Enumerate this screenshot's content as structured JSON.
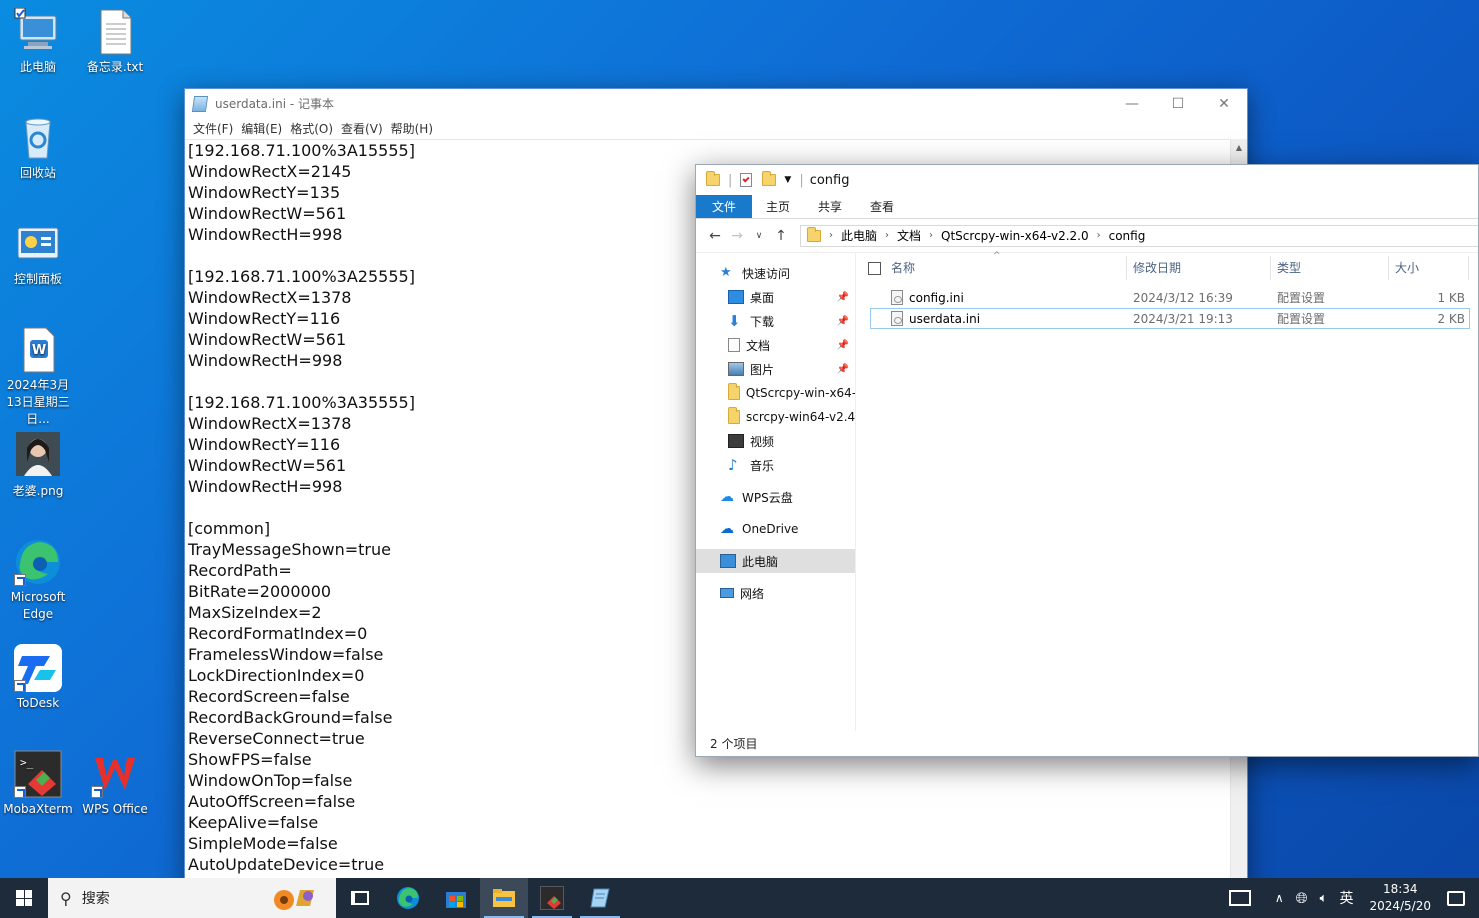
{
  "desktop": {
    "icons": [
      {
        "label": "此电脑"
      },
      {
        "label": "备忘录.txt"
      },
      {
        "label": "回收站"
      },
      {
        "label": "控制面板"
      },
      {
        "label": "2024年3月13日星期三 日..."
      },
      {
        "label": "老婆.png"
      },
      {
        "label": "Microsoft Edge"
      },
      {
        "label": "ToDesk"
      },
      {
        "label": "MobaXterm"
      },
      {
        "label": "WPS Office"
      }
    ]
  },
  "notepad": {
    "title": "userdata.ini - 记事本",
    "menu": [
      "文件(F)",
      "编辑(E)",
      "格式(O)",
      "查看(V)",
      "帮助(H)"
    ],
    "content": "[192.168.71.100%3A15555]\nWindowRectX=2145\nWindowRectY=135\nWindowRectW=561\nWindowRectH=998\n\n[192.168.71.100%3A25555]\nWindowRectX=1378\nWindowRectY=116\nWindowRectW=561\nWindowRectH=998\n\n[192.168.71.100%3A35555]\nWindowRectX=1378\nWindowRectY=116\nWindowRectW=561\nWindowRectH=998\n\n[common]\nTrayMessageShown=true\nRecordPath=\nBitRate=2000000\nMaxSizeIndex=2\nRecordFormatIndex=0\nFramelessWindow=false\nLockDirectionIndex=0\nRecordScreen=false\nRecordBackGround=false\nReverseConnect=true\nShowFPS=false\nWindowOnTop=false\nAutoOffScreen=false\nKeepAlive=false\nSimpleMode=false\nAutoUpdateDevice=true"
  },
  "explorer": {
    "title": "config",
    "ribbon_tabs": [
      "文件",
      "主页",
      "共享",
      "查看"
    ],
    "breadcrumb": [
      "此电脑",
      "文档",
      "QtScrcpy-win-x64-v2.2.0",
      "config"
    ],
    "nav": {
      "quick_access": "快速访问",
      "items": [
        {
          "label": "桌面",
          "pinned": true
        },
        {
          "label": "下载",
          "pinned": true
        },
        {
          "label": "文档",
          "pinned": true
        },
        {
          "label": "图片",
          "pinned": true
        },
        {
          "label": "QtScrcpy-win-x64-",
          "pinned": false
        },
        {
          "label": "scrcpy-win64-v2.4",
          "pinned": false
        },
        {
          "label": "视频",
          "pinned": false
        },
        {
          "label": "音乐",
          "pinned": false
        }
      ],
      "wps": "WPS云盘",
      "onedrive": "OneDrive",
      "this_pc": "此电脑",
      "network": "网络"
    },
    "columns": [
      "名称",
      "修改日期",
      "类型",
      "大小"
    ],
    "files": [
      {
        "name": "config.ini",
        "date": "2024/3/12 16:39",
        "type": "配置设置",
        "size": "1 KB"
      },
      {
        "name": "userdata.ini",
        "date": "2024/3/21 19:13",
        "type": "配置设置",
        "size": "2 KB"
      }
    ],
    "status": "2 个项目"
  },
  "taskbar": {
    "search_placeholder": "搜索",
    "ime": "英",
    "time": "18:34",
    "date": "2024/5/20"
  },
  "colors": {
    "accent": "#1979ca",
    "taskbar": "#1d2b3a"
  }
}
